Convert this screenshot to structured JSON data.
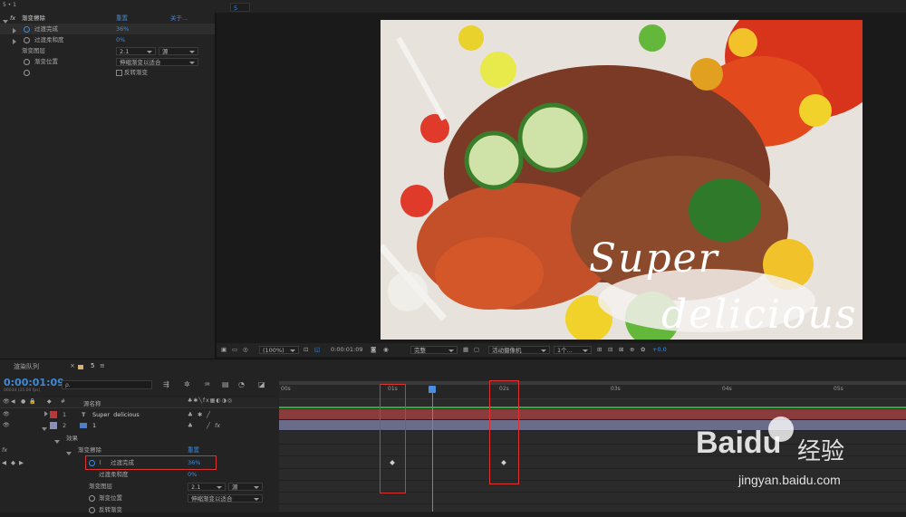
{
  "top_bar": {
    "panel_label": "5 • 1"
  },
  "effect_controls": {
    "effect_name": "渐变擦除",
    "reset_label": "重置",
    "about_label": "关于...",
    "props": [
      {
        "name": "过渡完成",
        "value": "36%"
      },
      {
        "name": "过渡柔和度",
        "value": "0%"
      },
      {
        "name": "渐变图层",
        "value": "2.1",
        "value2": "源"
      },
      {
        "name": "渐变位置",
        "value": "伸缩渐变以适合"
      },
      {
        "name": "",
        "value": "反转渐变"
      }
    ]
  },
  "viewer": {
    "comp_tab": "5",
    "overlay_text_1": "Super",
    "overlay_text_2": "delicious",
    "toolbar": {
      "zoom": "(100%)",
      "timecode": "0:00:01:09",
      "quality": "完整",
      "camera": "活动摄像机",
      "views": "1个...",
      "exposure": "+0.0"
    }
  },
  "timeline": {
    "tabs": [
      {
        "label": "渲染队列"
      },
      {
        "label": "5"
      }
    ],
    "current_time": "0:00:01:09",
    "fps": "00034 (25.00 fps)",
    "search_placeholder": "ρ.",
    "col_num": "#",
    "col_source": "源名称",
    "ruler": [
      "00s",
      "01s",
      "02s",
      "03s",
      "04s",
      "05s"
    ],
    "layers": [
      {
        "num": "1",
        "type_icon": "T",
        "name": "Super  delicious",
        "color": "#b8393a"
      },
      {
        "num": "2",
        "type_icon": "img",
        "name": "1",
        "color": "#8a8fb8"
      }
    ],
    "effects_label": "效果",
    "effect_name": "渐变擦除",
    "reset_label": "重置",
    "props": [
      {
        "name": "过渡完成",
        "value": "36%"
      },
      {
        "name": "过渡柔和度",
        "value": "0%"
      },
      {
        "name": "渐变图层",
        "value": "2.1",
        "value2": "源"
      },
      {
        "name": "渐变位置",
        "value": "伸缩渐变以适合"
      },
      {
        "name": "反转渐变",
        "value": ""
      }
    ]
  },
  "watermark": {
    "brand": "Baidu",
    "brand_cn": "经验",
    "url": "jingyan.baidu.com"
  },
  "colors": {
    "accent": "#3f8ad8",
    "highlight_box": "#dd3333",
    "playhead": "#4a8ee0"
  }
}
